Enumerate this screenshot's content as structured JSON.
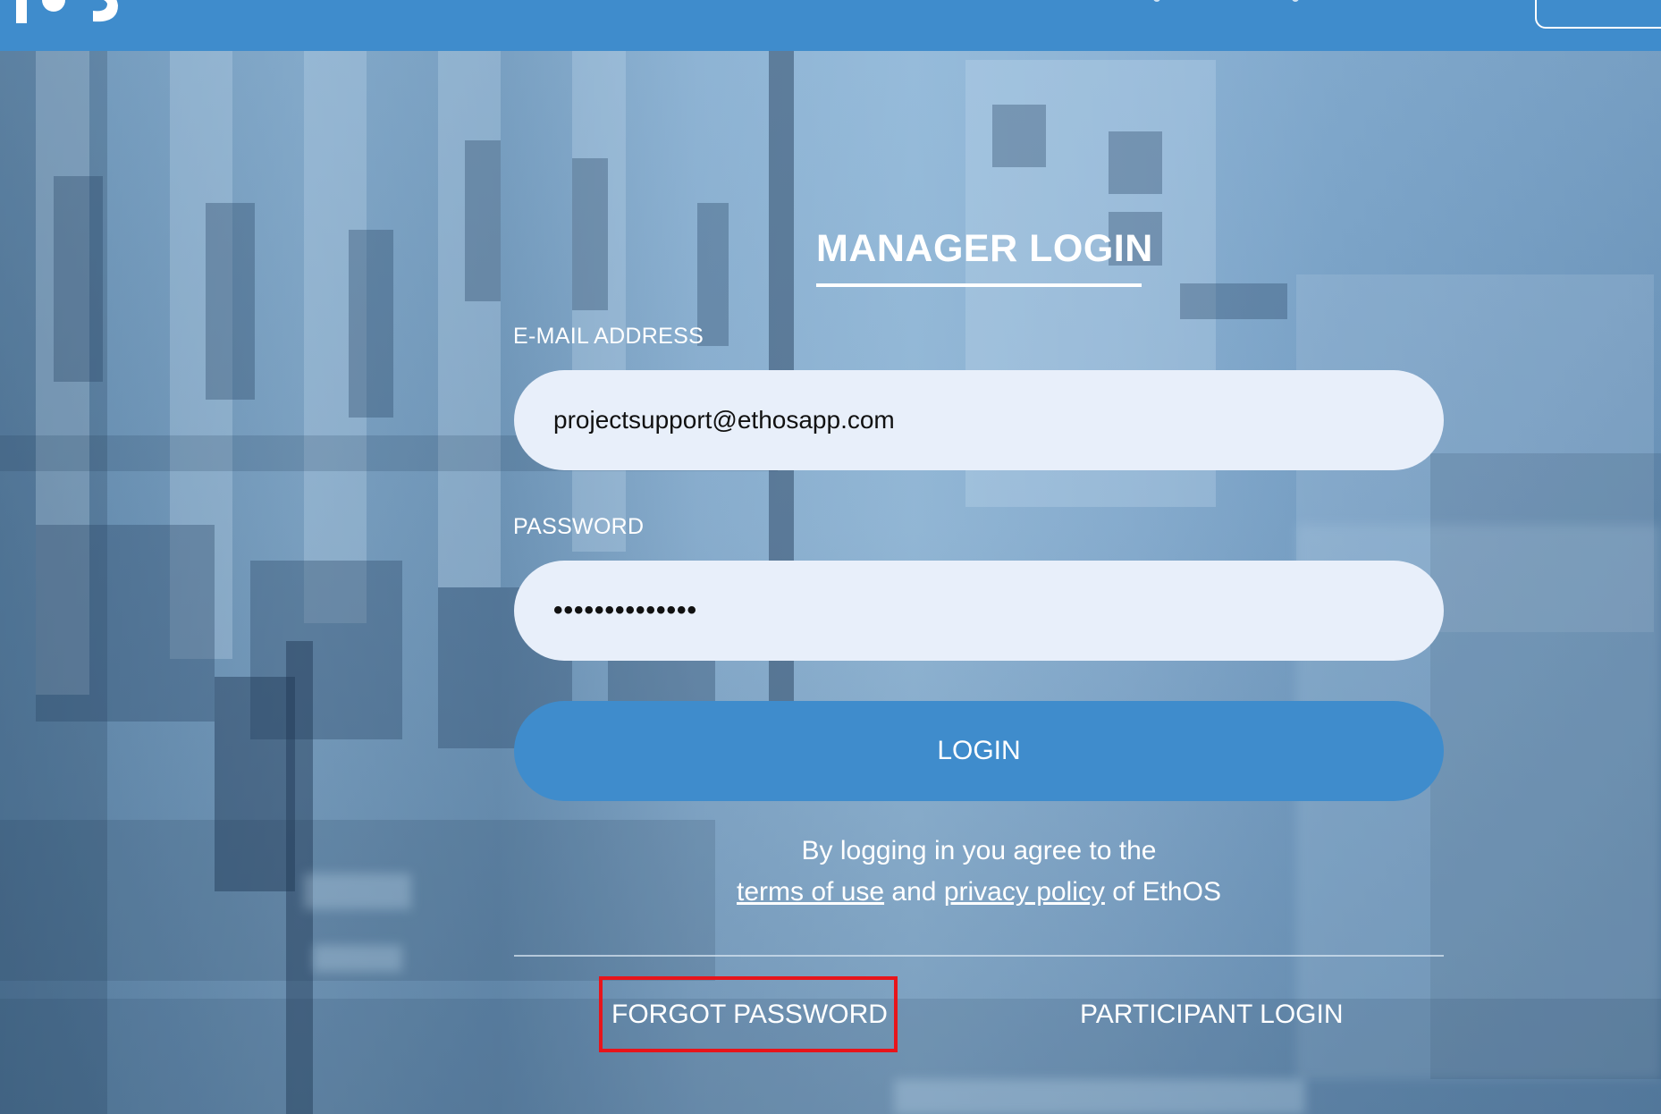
{
  "header": {
    "logo_icon": "ethos-logo-icon"
  },
  "login": {
    "title": "MANAGER LOGIN",
    "email_label": "E-MAIL ADDRESS",
    "email_value": "projectsupport@ethosapp.com",
    "password_label": "PASSWORD",
    "password_value": "••••••••••••••",
    "login_button": "LOGIN",
    "agree_line1": "By logging in you agree to the",
    "terms_link": "terms of use",
    "and_text": "and",
    "privacy_link": "privacy policy",
    "of_text": "of EthOS",
    "forgot_password": "FORGOT PASSWORD",
    "participant_login": "PARTICIPANT LOGIN"
  },
  "colors": {
    "accent": "#3f8ccc",
    "input_bg": "#e8effa",
    "highlight": "#e8141a"
  }
}
